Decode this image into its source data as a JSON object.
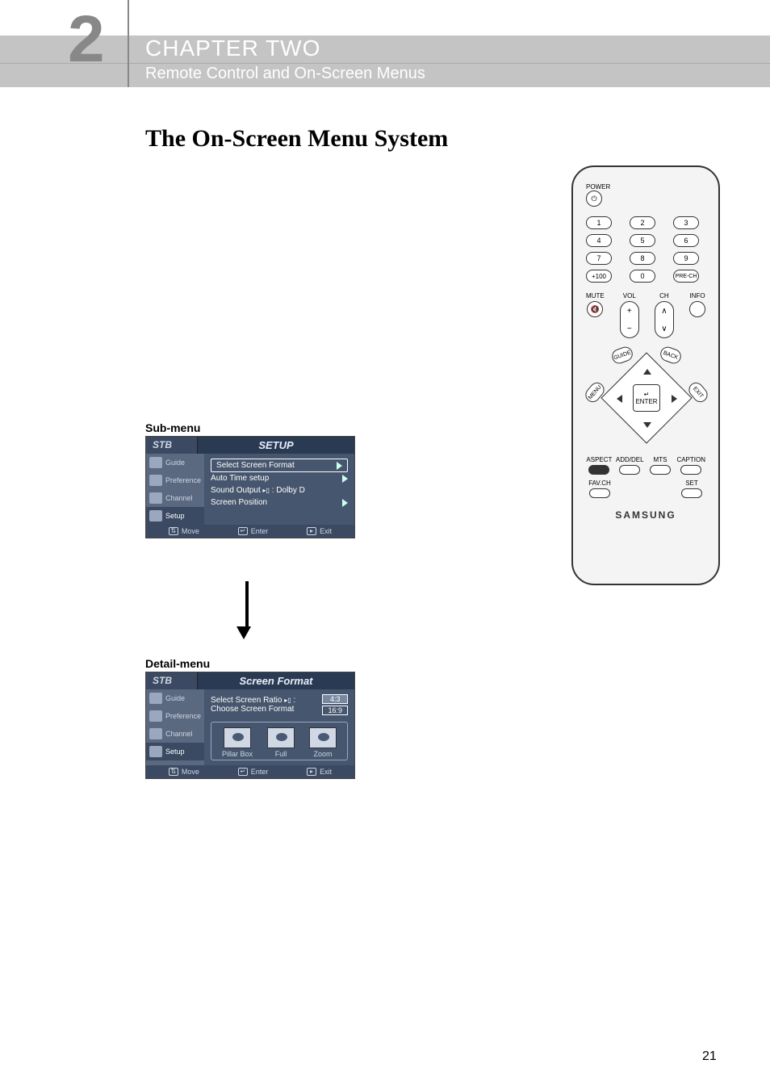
{
  "header": {
    "chapter_number": "2",
    "chapter_label": "CHAPTER TWO",
    "chapter_subtitle": "Remote Control and On-Screen Menus"
  },
  "section_title": "The On-Screen Menu System",
  "sub_menu_label": "Sub-menu",
  "detail_menu_label": "Detail-menu",
  "osd_setup": {
    "stb": "STB",
    "title": "SETUP",
    "side": [
      "Guide",
      "Preference",
      "Channel",
      "Setup"
    ],
    "rows": {
      "select_screen_format": "Select Screen Format",
      "auto_time_setup": "Auto Time setup",
      "sound_output": "Sound Output",
      "sound_output_value": ": Dolby D",
      "screen_position": "Screen Position"
    },
    "footer": {
      "move": "Move",
      "enter": "Enter",
      "exit": "Exit"
    }
  },
  "osd_format": {
    "stb": "STB",
    "title": "Screen Format",
    "side": [
      "Guide",
      "Preference",
      "Channel",
      "Setup"
    ],
    "select_ratio": "Select  Screen Ratio",
    "choose_format": "Choose Screen Format",
    "ratios": {
      "r43": "4:3",
      "r169": "16:9"
    },
    "thumbs": {
      "pillar": "Pillar Box",
      "full": "Full",
      "zoom": "Zoom"
    },
    "footer": {
      "move": "Move",
      "enter": "Enter",
      "exit": "Exit"
    }
  },
  "remote": {
    "power": "POWER",
    "numbers": [
      "1",
      "2",
      "3",
      "4",
      "5",
      "6",
      "7",
      "8",
      "9",
      "+100",
      "0",
      "PRE-CH"
    ],
    "vol": "VOL",
    "ch": "CH",
    "mute": "MUTE",
    "info": "INFO",
    "menu": "MENU",
    "exit": "EXIT",
    "guide": "GUIDE",
    "back": "BACK",
    "enter": "ENTER",
    "fn1": [
      "ASPECT",
      "ADD/DEL",
      "MTS",
      "CAPTION"
    ],
    "fn2": [
      "FAV.CH",
      "",
      "",
      "SET"
    ],
    "brand": "SAMSUNG"
  },
  "page_number": "21"
}
